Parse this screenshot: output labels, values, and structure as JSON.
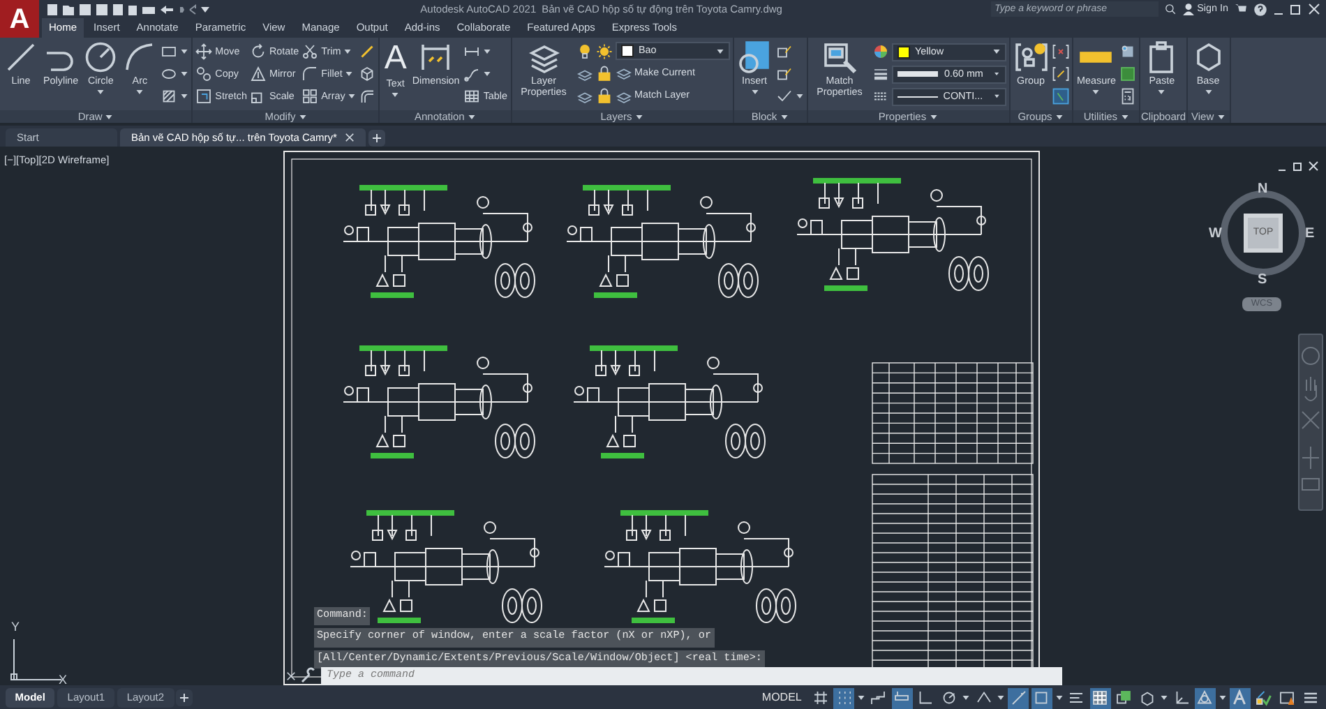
{
  "title_bar": {
    "logo": "A",
    "app": "Autodesk AutoCAD 2021",
    "file": "Bản vẽ CAD hộp số tự động trên Toyota Camry.dwg",
    "search": {
      "placeholder": "Type a keyword or phrase"
    },
    "sign_in": "Sign In"
  },
  "ribbon_tabs": [
    {
      "label": "Home",
      "selected": true
    },
    {
      "label": "Insert",
      "selected": false
    },
    {
      "label": "Annotate",
      "selected": false
    },
    {
      "label": "Parametric",
      "selected": false
    },
    {
      "label": "View",
      "selected": false
    },
    {
      "label": "Manage",
      "selected": false
    },
    {
      "label": "Output",
      "selected": false
    },
    {
      "label": "Add-ins",
      "selected": false
    },
    {
      "label": "Collaborate",
      "selected": false
    },
    {
      "label": "Featured Apps",
      "selected": false
    },
    {
      "label": "Express Tools",
      "selected": false
    }
  ],
  "ribbon_panels": [
    {
      "title": "Draw",
      "has_menu": true,
      "columns": [
        [
          {
            "kind": "large",
            "label": "Line",
            "dropdown": false
          }
        ],
        [
          {
            "kind": "large",
            "label": "Polyline",
            "dropdown": false
          }
        ],
        [
          {
            "kind": "large",
            "label": "Circle",
            "dropdown": true
          }
        ],
        [
          {
            "kind": "large",
            "label": "Arc",
            "dropdown": true
          }
        ],
        [
          {
            "kind": "small",
            "dropdown": true
          },
          {
            "kind": "small",
            "dropdown": true
          },
          {
            "kind": "small",
            "dropdown": true
          }
        ]
      ]
    },
    {
      "title": "Modify",
      "has_menu": true,
      "columns": [
        [
          {
            "kind": "small",
            "label": "Move",
            "dropdown": false
          },
          {
            "kind": "small",
            "label": "Copy",
            "dropdown": false
          },
          {
            "kind": "small",
            "label": "Stretch",
            "dropdown": false
          }
        ],
        [
          {
            "kind": "small",
            "label": "Rotate",
            "dropdown": false
          },
          {
            "kind": "small",
            "label": "Mirror",
            "dropdown": false
          },
          {
            "kind": "small",
            "label": "Scale",
            "dropdown": false
          }
        ],
        [
          {
            "kind": "small",
            "label": "Trim",
            "dropdown": true
          },
          {
            "kind": "small",
            "label": "Fillet",
            "dropdown": true
          },
          {
            "kind": "small",
            "label": "Array",
            "dropdown": true
          }
        ],
        [
          {
            "kind": "small",
            "dropdown": false
          },
          {
            "kind": "small",
            "dropdown": false
          },
          {
            "kind": "small",
            "dropdown": false
          }
        ]
      ]
    },
    {
      "title": "Annotation",
      "has_menu": true,
      "columns": [
        [
          {
            "kind": "large",
            "label": "Text",
            "glyph": "A",
            "dropdown": true
          }
        ],
        [
          {
            "kind": "large",
            "label": "Dimension",
            "dropdown": false
          }
        ],
        [
          {
            "kind": "small",
            "dropdown": true
          },
          {
            "kind": "small",
            "dropdown": true
          },
          {
            "kind": "small",
            "label": "Table",
            "dropdown": false
          }
        ]
      ]
    },
    {
      "title": "Layers",
      "has_menu": true,
      "columns": [
        [
          {
            "kind": "large",
            "label": "Layer Properties",
            "dropdown": false
          }
        ],
        [
          {
            "kind": "small",
            "dropdown": false
          },
          {
            "kind": "small",
            "dropdown": false
          },
          {
            "kind": "small",
            "dropdown": false
          }
        ],
        [
          {
            "kind": "small",
            "dropdown": false
          },
          {
            "kind": "small",
            "dropdown": false
          },
          {
            "kind": "small",
            "dropdown": false
          }
        ],
        [
          {
            "kind": "combo",
            "value": "Bao",
            "color": "#ffffff"
          },
          {
            "kind": "small",
            "label": "Make Current",
            "dropdown": false
          },
          {
            "kind": "small",
            "label": "Match Layer",
            "dropdown": false
          }
        ]
      ]
    },
    {
      "title": "Block",
      "has_menu": true,
      "columns": [
        [
          {
            "kind": "large",
            "label": "Insert",
            "dropdown": true
          }
        ],
        [
          {
            "kind": "small",
            "dropdown": false
          },
          {
            "kind": "small",
            "dropdown": false
          },
          {
            "kind": "small",
            "dropdown": true
          }
        ]
      ]
    },
    {
      "title": "Properties",
      "has_menu": true,
      "columns": [
        [
          {
            "kind": "large",
            "label": "Match Properties",
            "dropdown": false
          }
        ],
        [
          {
            "kind": "small",
            "dropdown": false
          },
          {
            "kind": "small",
            "dropdown": false
          },
          {
            "kind": "small",
            "dropdown": false
          }
        ],
        [
          {
            "kind": "combo",
            "value": "Yellow",
            "color": "#ffff00"
          },
          {
            "kind": "combo",
            "value": "0.60 mm"
          },
          {
            "kind": "combo",
            "value": "CONTI..."
          }
        ]
      ]
    },
    {
      "title": "Groups",
      "has_menu": true,
      "columns": [
        [
          {
            "kind": "large",
            "label": "Group",
            "dropdown": false
          }
        ],
        [
          {
            "kind": "small",
            "dropdown": false
          },
          {
            "kind": "small",
            "dropdown": false
          },
          {
            "kind": "small",
            "dropdown": false
          }
        ]
      ]
    },
    {
      "title": "Utilities",
      "has_menu": true,
      "columns": [
        [
          {
            "kind": "large",
            "label": "Measure",
            "dropdown": true
          }
        ],
        [
          {
            "kind": "small",
            "dropdown": false
          },
          {
            "kind": "small",
            "dropdown": false
          },
          {
            "kind": "small",
            "dropdown": false
          }
        ]
      ]
    },
    {
      "title": "Clipboard",
      "has_menu": false,
      "columns": [
        [
          {
            "kind": "large",
            "label": "Paste",
            "dropdown": true
          }
        ]
      ]
    },
    {
      "title": "View",
      "has_menu": true,
      "columns": [
        [
          {
            "kind": "large",
            "label": "Base",
            "dropdown": true
          }
        ]
      ]
    }
  ],
  "doc_tabs": [
    {
      "label": "Start",
      "selected": false
    },
    {
      "label": "Bản vẽ CAD hộp số tự... trên Toyota Camry*",
      "selected": true
    }
  ],
  "viewport": {
    "label": "[−][Top][2D Wireframe]",
    "viewcube": {
      "face": "TOP",
      "north": "N",
      "south": "S",
      "east": "E",
      "west": "W",
      "ucs": "WCS"
    },
    "ucs_axes": {
      "x": "X",
      "y": "Y"
    }
  },
  "command_line": {
    "history": [
      "Command:",
      "Specify corner of window, enter a scale factor (nX or nXP), or",
      "[All/Center/Dynamic/Extents/Previous/Scale/Window/Object] <real time>:"
    ],
    "placeholder": "Type a command"
  },
  "layout_tabs": [
    {
      "label": "Model",
      "selected": true
    },
    {
      "label": "Layout1",
      "selected": false
    },
    {
      "label": "Layout2",
      "selected": false
    }
  ],
  "status_bar": {
    "mode": "MODEL",
    "toggles": [
      {
        "on": false,
        "dropdown": false
      },
      {
        "on": true,
        "dropdown": true
      },
      {
        "on": false,
        "dropdown": false
      },
      {
        "on": true,
        "dropdown": false
      },
      {
        "on": false,
        "dropdown": false
      },
      {
        "on": false,
        "dropdown": true
      },
      {
        "on": false,
        "dropdown": true
      },
      {
        "on": true,
        "dropdown": false
      },
      {
        "on": true,
        "dropdown": true
      },
      {
        "on": false,
        "dropdown": false
      },
      {
        "on": true,
        "dropdown": false
      },
      {
        "on": false,
        "dropdown": false
      },
      {
        "on": false,
        "dropdown": true
      },
      {
        "on": false,
        "dropdown": false
      },
      {
        "on": true,
        "dropdown": true
      },
      {
        "on": true,
        "dropdown": false
      },
      {
        "on": false,
        "dropdown": false
      },
      {
        "on": false,
        "dropdown": false
      },
      {
        "on": false,
        "dropdown": false
      }
    ]
  }
}
